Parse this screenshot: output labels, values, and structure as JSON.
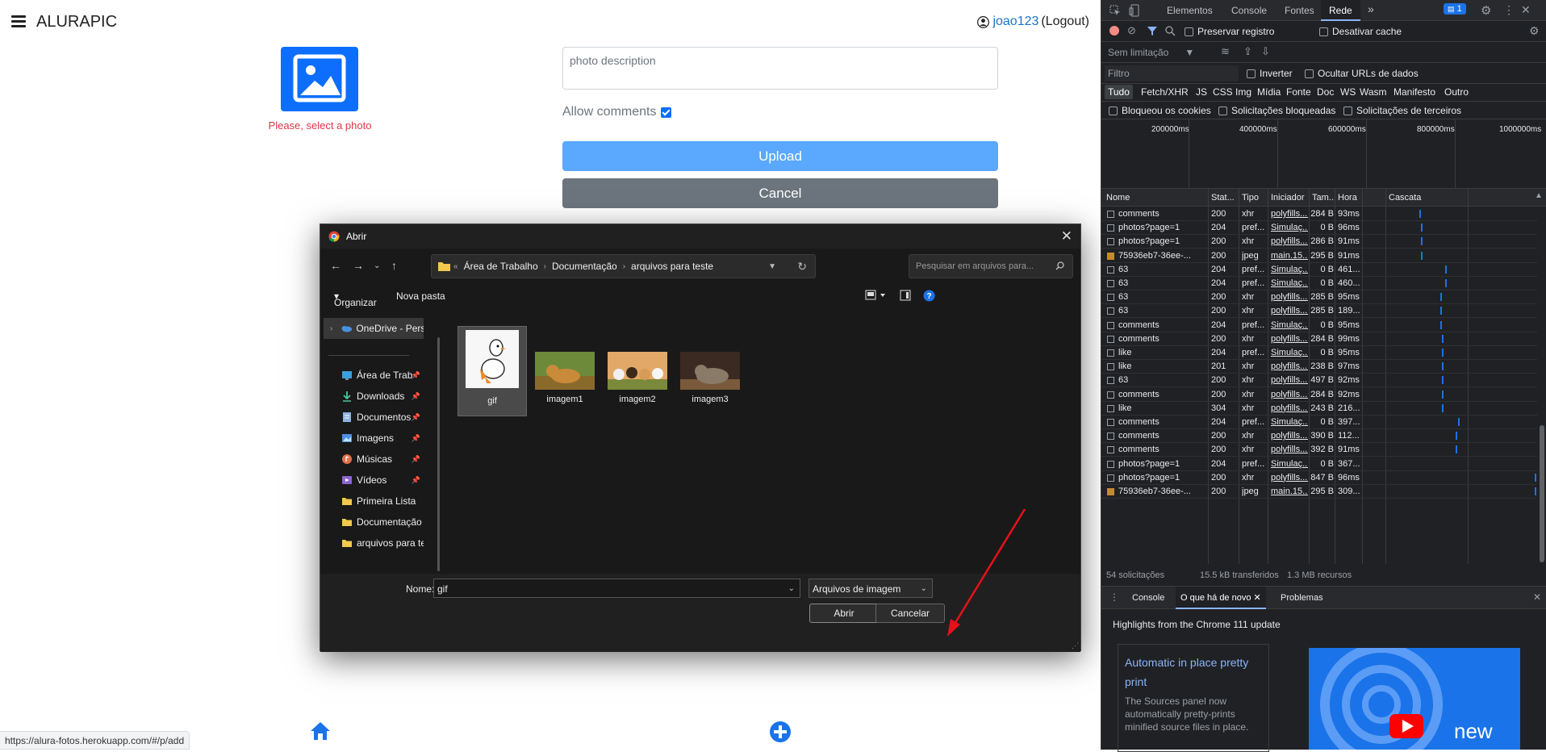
{
  "app": {
    "brand": "ALURAPIC",
    "user": "joao123",
    "logout": "(Logout)",
    "photo_error": "Please, select a photo",
    "description_placeholder": "photo description",
    "allow_comments": "Allow comments",
    "upload": "Upload",
    "cancel": "Cancel",
    "status_url": "https://alura-fotos.herokuapp.com/#/p/add",
    "colors": {
      "primary": "#0d6efd",
      "upload": "#5aa8ff",
      "cancel": "#6c757d",
      "error": "#dc3545"
    }
  },
  "dialog": {
    "title": "Abrir",
    "breadcrumb": [
      "Área de Trabalho",
      "Documentação",
      "arquivos para teste"
    ],
    "search_placeholder": "Pesquisar em arquivos para...",
    "organize": "Organizar",
    "new_folder": "Nova pasta",
    "sidebar": {
      "top": "OneDrive - Perso",
      "items": [
        {
          "label": "Área de Trab",
          "icon": "desktop-icon",
          "pinned": true
        },
        {
          "label": "Downloads",
          "icon": "download-icon",
          "pinned": true
        },
        {
          "label": "Documentos",
          "icon": "documents-icon",
          "pinned": true
        },
        {
          "label": "Imagens",
          "icon": "images-icon",
          "pinned": true
        },
        {
          "label": "Músicas",
          "icon": "music-icon",
          "pinned": true
        },
        {
          "label": "Vídeos",
          "icon": "videos-icon",
          "pinned": true
        },
        {
          "label": "Primeira Lista",
          "icon": "folder-icon",
          "pinned": false
        },
        {
          "label": "Documentação",
          "icon": "folder-icon",
          "pinned": false
        },
        {
          "label": "arquivos para te",
          "icon": "folder-icon",
          "pinned": false
        }
      ]
    },
    "files": [
      "gif",
      "imagem1",
      "imagem2",
      "imagem3"
    ],
    "selected_file": "gif",
    "name_label": "Nome:",
    "name_value": "gif",
    "file_type": "Arquivos de imagem",
    "open": "Abrir",
    "cancel": "Cancelar"
  },
  "devtools": {
    "tabs": [
      "Elementos",
      "Console",
      "Fontes",
      "Rede"
    ],
    "active_tab": "Rede",
    "badge": "1",
    "preserve_log": "Preservar registro",
    "disable_cache": "Desativar cache",
    "throttle": "Sem limitação",
    "filter_placeholder": "Filtro",
    "invert": "Inverter",
    "hide_data_urls": "Ocultar URLs de dados",
    "types": [
      "Tudo",
      "Fetch/XHR",
      "JS",
      "CSS",
      "Img",
      "Mídia",
      "Fonte",
      "Doc",
      "WS",
      "Wasm",
      "Manifesto",
      "Outro"
    ],
    "blocked_cookies": "Bloqueou os cookies",
    "blocked_requests": "Solicitações bloqueadas",
    "third_party": "Solicitações de terceiros",
    "timeline_ticks": [
      "200000ms",
      "400000ms",
      "600000ms",
      "800000ms",
      "1000000ms"
    ],
    "columns": [
      "Nome",
      "Stat...",
      "Tipo",
      "Iniciador",
      "Tam...",
      "Hora",
      "Cascata"
    ],
    "requests": [
      {
        "name": "comments",
        "status": "200",
        "type": "xhr",
        "initiator": "polyfills....",
        "size": "284 B",
        "time": "93ms",
        "wf": 0.21
      },
      {
        "name": "photos?page=1",
        "status": "204",
        "type": "pref...",
        "initiator": "Simulaç...",
        "size": "0 B",
        "time": "96ms",
        "wf": 0.22
      },
      {
        "name": "photos?page=1",
        "status": "200",
        "type": "xhr",
        "initiator": "polyfills....",
        "size": "286 B",
        "time": "91ms",
        "wf": 0.22
      },
      {
        "name": "75936eb7-36ee-...",
        "status": "200",
        "type": "jpeg",
        "initiator": "main.15...",
        "size": "295 B",
        "time": "91ms",
        "wf": 0.22,
        "img": true
      },
      {
        "name": "63",
        "status": "204",
        "type": "pref...",
        "initiator": "Simulaç...",
        "size": "0 B",
        "time": "461...",
        "wf": 0.38
      },
      {
        "name": "63",
        "status": "204",
        "type": "pref...",
        "initiator": "Simulaç...",
        "size": "0 B",
        "time": "460...",
        "wf": 0.38
      },
      {
        "name": "63",
        "status": "200",
        "type": "xhr",
        "initiator": "polyfills....",
        "size": "285 B",
        "time": "95ms",
        "wf": 0.35
      },
      {
        "name": "63",
        "status": "200",
        "type": "xhr",
        "initiator": "polyfills....",
        "size": "285 B",
        "time": "189...",
        "wf": 0.35
      },
      {
        "name": "comments",
        "status": "204",
        "type": "pref...",
        "initiator": "Simulaç...",
        "size": "0 B",
        "time": "95ms",
        "wf": 0.35
      },
      {
        "name": "comments",
        "status": "200",
        "type": "xhr",
        "initiator": "polyfills....",
        "size": "284 B",
        "time": "99ms",
        "wf": 0.36
      },
      {
        "name": "like",
        "status": "204",
        "type": "pref...",
        "initiator": "Simulaç...",
        "size": "0 B",
        "time": "95ms",
        "wf": 0.36
      },
      {
        "name": "like",
        "status": "201",
        "type": "xhr",
        "initiator": "polyfills....",
        "size": "238 B",
        "time": "97ms",
        "wf": 0.36
      },
      {
        "name": "63",
        "status": "200",
        "type": "xhr",
        "initiator": "polyfills....",
        "size": "497 B",
        "time": "92ms",
        "wf": 0.36
      },
      {
        "name": "comments",
        "status": "200",
        "type": "xhr",
        "initiator": "polyfills....",
        "size": "284 B",
        "time": "92ms",
        "wf": 0.36
      },
      {
        "name": "like",
        "status": "304",
        "type": "xhr",
        "initiator": "polyfills....",
        "size": "243 B",
        "time": "216...",
        "wf": 0.36
      },
      {
        "name": "comments",
        "status": "204",
        "type": "pref...",
        "initiator": "Simulaç...",
        "size": "0 B",
        "time": "397...",
        "wf": 0.47
      },
      {
        "name": "comments",
        "status": "200",
        "type": "xhr",
        "initiator": "polyfills....",
        "size": "390 B",
        "time": "112...",
        "wf": 0.45
      },
      {
        "name": "comments",
        "status": "200",
        "type": "xhr",
        "initiator": "polyfills....",
        "size": "392 B",
        "time": "91ms",
        "wf": 0.45
      },
      {
        "name": "photos?page=1",
        "status": "204",
        "type": "pref...",
        "initiator": "Simulaç...",
        "size": "0 B",
        "time": "367...",
        "wf": null
      },
      {
        "name": "photos?page=1",
        "status": "200",
        "type": "xhr",
        "initiator": "polyfills....",
        "size": "847 B",
        "time": "96ms",
        "wf": 0.98
      },
      {
        "name": "75936eb7-36ee-...",
        "status": "200",
        "type": "jpeg",
        "initiator": "main.15...",
        "size": "295 B",
        "time": "309...",
        "wf": 0.98,
        "img": true
      }
    ],
    "summary": [
      "54 solicitações",
      "15.5 kB transferidos",
      "1.3 MB recursos"
    ],
    "drawer_tabs": [
      "Console",
      "O que há de novo",
      "Problemas"
    ],
    "drawer_active": "O que há de novo",
    "highlights": "Highlights from the Chrome 111 update",
    "card_title_1": "Automatic in place pretty",
    "card_title_2": "print",
    "card_text": "The Sources panel now automatically pretty-prints minified source files in place.",
    "promo_word": "new"
  }
}
